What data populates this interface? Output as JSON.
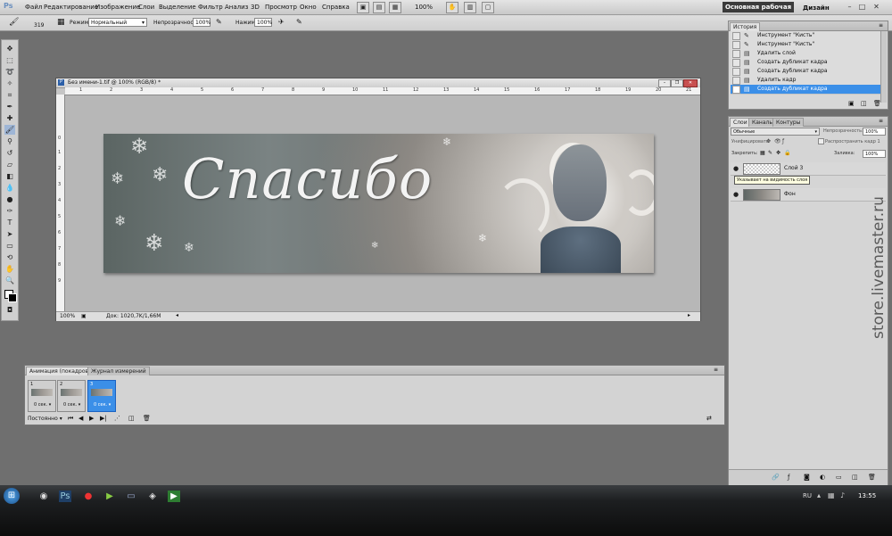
{
  "app": {
    "logo": "Ps"
  },
  "menu": {
    "items": [
      "Файл",
      "Редактирование",
      "Изображение",
      "Слои",
      "Выделение",
      "Фильтр",
      "Анализ",
      "3D",
      "Просмотр",
      "Окно",
      "Справка"
    ],
    "zoom": "100%",
    "workspace": "Основная рабочая среда",
    "design": "Дизайн"
  },
  "options": {
    "brush_size": "319",
    "mode_label": "Режим:",
    "mode_value": "Нормальный",
    "opacity_label": "Непрозрачность:",
    "opacity_value": "100%",
    "flow_label": "Нажим:",
    "flow_value": "100%"
  },
  "document": {
    "title": "Без имени-1.tif @ 100% (RGB/8) *",
    "zoom": "100%",
    "doc_info": "Док: 1020,7K/1,66M",
    "ruler_h": [
      "1",
      "2",
      "3",
      "4",
      "5",
      "6",
      "7",
      "8",
      "9",
      "10",
      "11",
      "12",
      "13",
      "14",
      "15",
      "16",
      "17",
      "18",
      "19",
      "20",
      "21"
    ],
    "ruler_v": [
      "0",
      "1",
      "2",
      "3",
      "4",
      "5",
      "6",
      "7",
      "8",
      "9"
    ],
    "artwork_title": "Спасибо"
  },
  "history": {
    "tab": "История",
    "rows": [
      {
        "label": "Инструмент \"Кисть\"",
        "icon": "brush-icon",
        "selected": false
      },
      {
        "label": "Инструмент \"Кисть\"",
        "icon": "brush-icon",
        "selected": false
      },
      {
        "label": "Удалить слой",
        "icon": "history-state-icon",
        "selected": false
      },
      {
        "label": "Создать дубликат кадра",
        "icon": "history-state-icon",
        "selected": false
      },
      {
        "label": "Создать дубликат кадра",
        "icon": "history-state-icon",
        "selected": false
      },
      {
        "label": "Удалить кадр",
        "icon": "history-state-icon",
        "selected": false
      },
      {
        "label": "Создать дубликат кадра",
        "icon": "history-state-icon",
        "selected": true
      }
    ]
  },
  "layers": {
    "tabs": [
      "Слои",
      "Каналы",
      "Контуры"
    ],
    "blend_mode": "Обычные",
    "opacity_label": "Непрозрачность:",
    "opacity_value": "100%",
    "unify_label": "Унифицировать:",
    "propagate_label": "Распространить кадр 1",
    "lock_label": "Закрепить:",
    "fill_label": "Заливка:",
    "fill_value": "100%",
    "tooltip": "Указывает на видимость слоя",
    "rows": [
      {
        "name": "Слой 3"
      },
      {
        "name": "Фон"
      }
    ]
  },
  "animation": {
    "tab_active": "Анимация (покадровая)",
    "tab_other": "Журнал измерений",
    "frames": [
      {
        "num": "1",
        "delay": "0 сек.",
        "selected": false
      },
      {
        "num": "2",
        "delay": "0 сек.",
        "selected": false
      },
      {
        "num": "3",
        "delay": "0 сек.",
        "selected": true
      }
    ],
    "loop": "Постоянно"
  },
  "taskbar": {
    "lang": "RU",
    "time": "13:55"
  },
  "watermark": "store.livemaster.ru",
  "colors": {
    "selection": "#3b8fe8",
    "workspace_bg": "#6f6f6f"
  }
}
